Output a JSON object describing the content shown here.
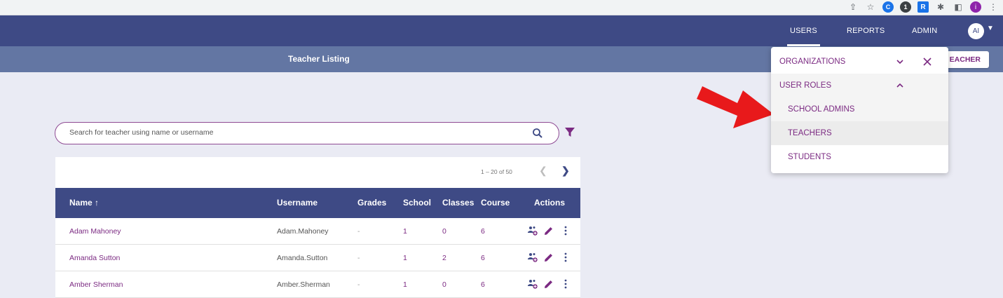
{
  "browser": {
    "icons": [
      "share-icon",
      "star-icon",
      "extension-c-icon",
      "onepassword-icon",
      "extension-r-icon",
      "puzzle-icon",
      "sidepanel-icon",
      "profile-icon",
      "kebab-icon"
    ],
    "profile_letter": "i"
  },
  "nav": {
    "links": [
      "USERS",
      "REPORTS",
      "ADMIN"
    ],
    "avatar": "AI"
  },
  "subheader": {
    "title": "Teacher Listing",
    "add_button": "EACHER"
  },
  "search": {
    "placeholder": "Search for teacher using name or username"
  },
  "pager": {
    "range": "1 – 20 of 50"
  },
  "table": {
    "columns": [
      "Name ↑",
      "Username",
      "Grades",
      "School",
      "Classes",
      "Course",
      "Actions"
    ],
    "rows": [
      {
        "name": "Adam Mahoney",
        "username": "Adam.Mahoney",
        "grades": "-",
        "school": "1",
        "classes": "0",
        "course": "6"
      },
      {
        "name": "Amanda Sutton",
        "username": "Amanda.Sutton",
        "grades": "-",
        "school": "1",
        "classes": "2",
        "course": "6"
      },
      {
        "name": "Amber Sherman",
        "username": "Amber.Sherman",
        "grades": "-",
        "school": "1",
        "classes": "0",
        "course": "6"
      }
    ]
  },
  "menu": {
    "organizations": "ORGANIZATIONS",
    "user_roles": "USER ROLES",
    "items": [
      "SCHOOL ADMINS",
      "TEACHERS",
      "STUDENTS"
    ]
  },
  "colors": {
    "nav": "#3e4a85",
    "subheader": "#6376a3",
    "accent": "#7b2a82",
    "annotation_arrow": "#e8191b"
  }
}
